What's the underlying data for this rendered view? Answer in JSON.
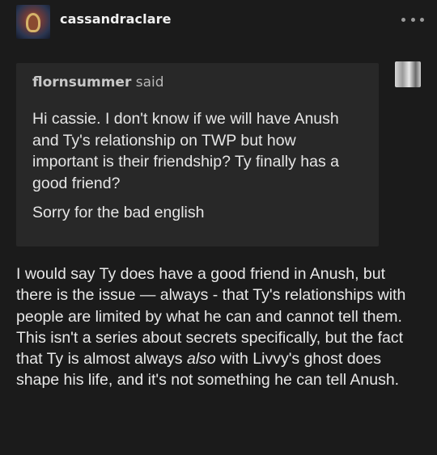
{
  "post": {
    "username": "cassandraclare",
    "more_icon": "ellipsis-icon"
  },
  "ask": {
    "asker_name": "flornsummer",
    "asker_suffix": " said",
    "question_lines": [
      "Hi cassie.  I don't know if we will have Anush and Ty's relationship on TWP but how important is their friendship?  Ty finally has a good friend?",
      "Sorry for the bad english"
    ]
  },
  "answer": {
    "text_before": "I would say Ty does have a good friend in Anush, but there is the issue — always - that Ty's relationships with people are limited by what he can and cannot tell them. This isn't a series about secrets specifically, but the fact that Ty is almost always ",
    "emphasis": "also",
    "text_after": " with Livvy's ghost does shape his life, and it's not something he can tell Anush."
  }
}
